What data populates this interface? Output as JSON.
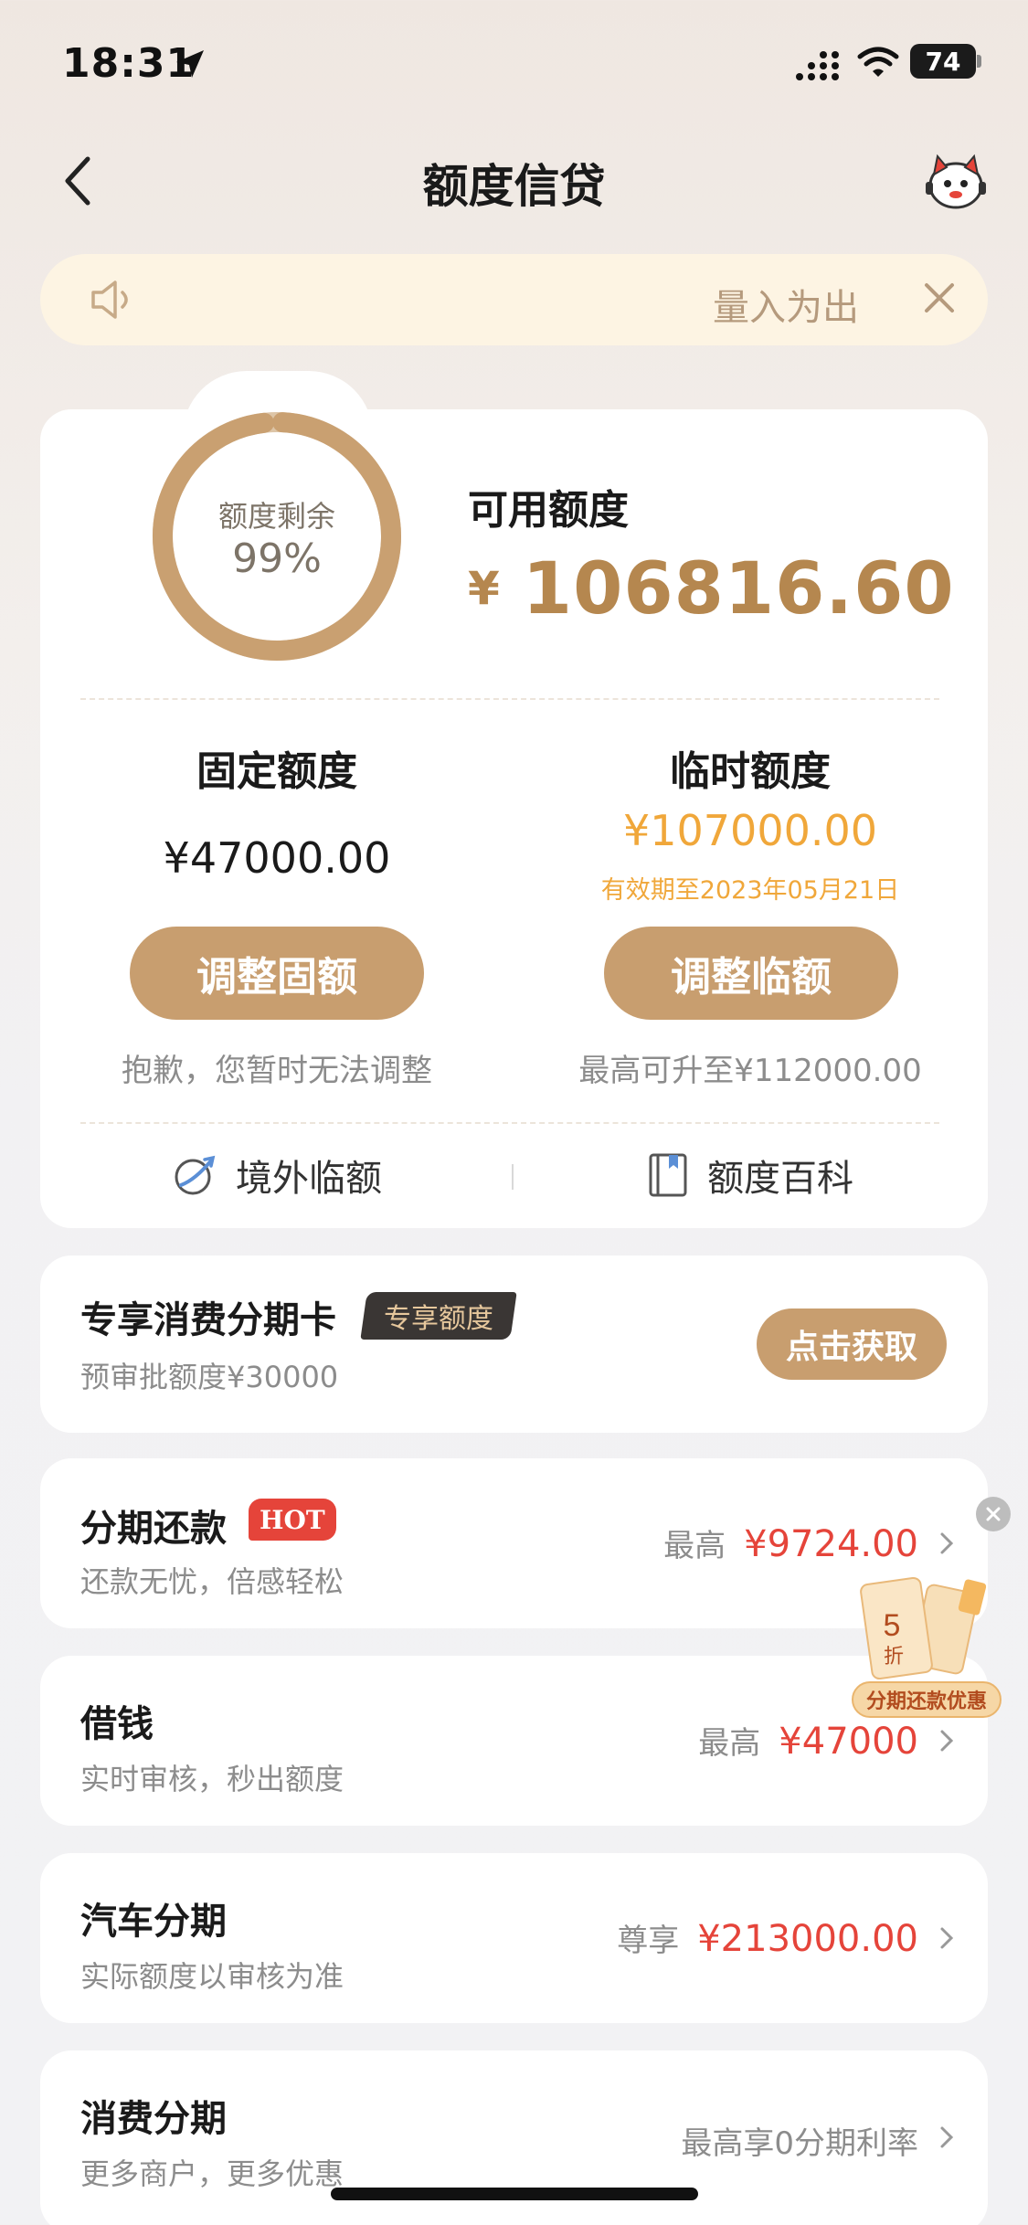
{
  "status_bar": {
    "time": "18:31",
    "battery": "74"
  },
  "nav": {
    "title": "额度信贷"
  },
  "notice": {
    "text": "量入为出"
  },
  "credit": {
    "ring_label": "额度剩余",
    "ring_percent": "99%",
    "ring_fraction": 0.99,
    "available_label": "可用额度",
    "available_currency": "¥",
    "available_amount": "106816.60",
    "fixed_title": "固定额度",
    "fixed_amount": "¥47000.00",
    "fixed_button": "调整固额",
    "fixed_note": "抱歉，您暂时无法调整",
    "temp_title": "临时额度",
    "temp_amount": "¥107000.00",
    "temp_valid": "有效期至2023年05月21日",
    "temp_button": "调整临额",
    "temp_note": "最高可升至¥112000.00",
    "overseas_label": "境外临额",
    "wiki_label": "额度百科"
  },
  "installment_card": {
    "title": "专享消费分期卡",
    "badge": "专享额度",
    "subtitle": "预审批额度¥30000",
    "button": "点击获取"
  },
  "items": [
    {
      "title": "分期还款",
      "badge": "HOT",
      "subtitle": "还款无忧，倍感轻松",
      "prefix": "最高",
      "value": "¥9724.00"
    },
    {
      "title": "借钱",
      "subtitle": "实时审核，秒出额度",
      "prefix": "最高",
      "value": "¥47000"
    },
    {
      "title": "汽车分期",
      "subtitle": "实际额度以审核为准",
      "prefix": "尊享",
      "value": "¥213000.00"
    },
    {
      "title": "消费分期",
      "subtitle": "更多商户，更多优惠",
      "prefix": "最高享0分期利率",
      "value": ""
    }
  ],
  "floating_promo": {
    "discount_number": "5",
    "discount_unit": "折",
    "label": "分期还款优惠"
  },
  "colors": {
    "gold": "#c89e6f",
    "amount_gold": "#b5874f",
    "temp_orange": "#f0a73a",
    "red": "#e5443a"
  }
}
